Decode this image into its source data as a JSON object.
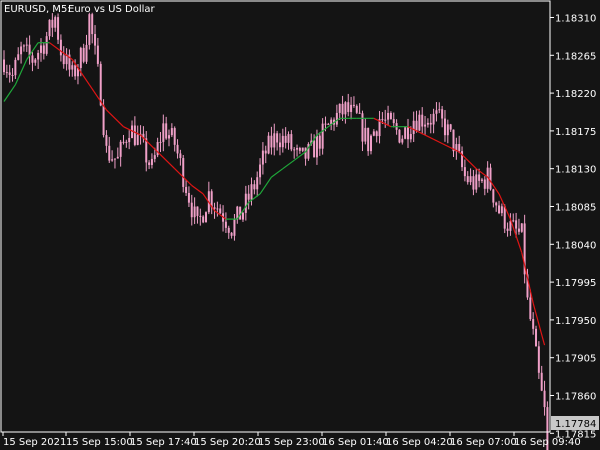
{
  "header": {
    "symbol_timeframe": "EURUSD, M5:",
    "description": "Euro vs US Dollar"
  },
  "colors": {
    "background": "#141414",
    "frame": "#ffffff",
    "tick_text": "#ffffff",
    "candle": "#f0a0c8",
    "ma_up": "#1fa83a",
    "ma_down": "#e01414",
    "price_box_bg": "#c8c8c8"
  },
  "chart_data": {
    "type": "candlestick",
    "symbol": "EURUSD",
    "timeframe": "M5",
    "y_axis": {
      "ticks": [
        "1.18310",
        "1.18265",
        "1.18220",
        "1.18175",
        "1.18130",
        "1.18085",
        "1.18040",
        "1.17995",
        "1.17950",
        "1.17905",
        "1.17860",
        "1.17815"
      ],
      "range": [
        1.1777,
        1.1834
      ]
    },
    "x_axis": {
      "ticks": [
        "15 Sep 2021",
        "15 Sep 15:00",
        "15 Sep 17:40",
        "15 Sep 20:20",
        "15 Sep 23:00",
        "16 Sep 01:40",
        "16 Sep 04:20",
        "16 Sep 07:00",
        "16 Sep 09:40"
      ]
    },
    "current_price": "1.17784",
    "price_path": [
      [
        0,
        1.1826
      ],
      [
        3,
        1.1824
      ],
      [
        6,
        1.1827
      ],
      [
        10,
        1.1826
      ],
      [
        14,
        1.1828
      ],
      [
        18,
        1.1831
      ],
      [
        20,
        1.1827
      ],
      [
        24,
        1.1824
      ],
      [
        28,
        1.1827
      ],
      [
        30,
        1.1831
      ],
      [
        34,
        1.1822
      ],
      [
        36,
        1.1815
      ],
      [
        40,
        1.1814
      ],
      [
        44,
        1.1818
      ],
      [
        48,
        1.1816
      ],
      [
        52,
        1.1813
      ],
      [
        56,
        1.1818
      ],
      [
        60,
        1.1816
      ],
      [
        64,
        1.1811
      ],
      [
        68,
        1.1806
      ],
      [
        72,
        1.181
      ],
      [
        76,
        1.1808
      ],
      [
        80,
        1.1806
      ],
      [
        84,
        1.1808
      ],
      [
        88,
        1.1811
      ],
      [
        92,
        1.1815
      ],
      [
        96,
        1.1817
      ],
      [
        100,
        1.1816
      ],
      [
        104,
        1.1814
      ],
      [
        108,
        1.1815
      ],
      [
        112,
        1.1817
      ],
      [
        116,
        1.1819
      ],
      [
        120,
        1.182
      ],
      [
        124,
        1.1819
      ],
      [
        128,
        1.1816
      ],
      [
        132,
        1.1819
      ],
      [
        136,
        1.1818
      ],
      [
        140,
        1.1817
      ],
      [
        144,
        1.1819
      ],
      [
        148,
        1.1819
      ],
      [
        152,
        1.1819
      ],
      [
        155,
        1.1818
      ],
      [
        158,
        1.1816
      ],
      [
        162,
        1.1812
      ],
      [
        166,
        1.1811
      ],
      [
        170,
        1.1812
      ],
      [
        174,
        1.1808
      ],
      [
        178,
        1.1806
      ],
      [
        182,
        1.1805
      ],
      [
        184,
        1.1797
      ],
      [
        186,
        1.1793
      ],
      [
        188,
        1.1788
      ],
      [
        190,
        1.1784
      ],
      [
        191,
        1.1778
      ]
    ],
    "moving_average": [
      [
        0,
        1.1821
      ],
      [
        4,
        1.1823
      ],
      [
        8,
        1.1826
      ],
      [
        12,
        1.1828
      ],
      [
        16,
        1.1828
      ],
      [
        20,
        1.1827
      ],
      [
        24,
        1.1826
      ],
      [
        30,
        1.1823
      ],
      [
        36,
        1.182
      ],
      [
        42,
        1.1818
      ],
      [
        48,
        1.1817
      ],
      [
        54,
        1.1815
      ],
      [
        60,
        1.1813
      ],
      [
        66,
        1.1811
      ],
      [
        70,
        1.181
      ],
      [
        74,
        1.1808
      ],
      [
        78,
        1.1807
      ],
      [
        82,
        1.1807
      ],
      [
        86,
        1.1809
      ],
      [
        90,
        1.181
      ],
      [
        94,
        1.1812
      ],
      [
        98,
        1.1813
      ],
      [
        102,
        1.1814
      ],
      [
        106,
        1.1815
      ],
      [
        110,
        1.1817
      ],
      [
        114,
        1.1818
      ],
      [
        118,
        1.1819
      ],
      [
        124,
        1.1819
      ],
      [
        130,
        1.1819
      ],
      [
        136,
        1.1818
      ],
      [
        142,
        1.1818
      ],
      [
        148,
        1.1817
      ],
      [
        154,
        1.1816
      ],
      [
        160,
        1.1815
      ],
      [
        166,
        1.1813
      ],
      [
        170,
        1.1812
      ],
      [
        174,
        1.181
      ],
      [
        178,
        1.1807
      ],
      [
        182,
        1.1803
      ],
      [
        186,
        1.1797
      ],
      [
        190,
        1.1792
      ]
    ],
    "grid": false,
    "legend": "none"
  }
}
